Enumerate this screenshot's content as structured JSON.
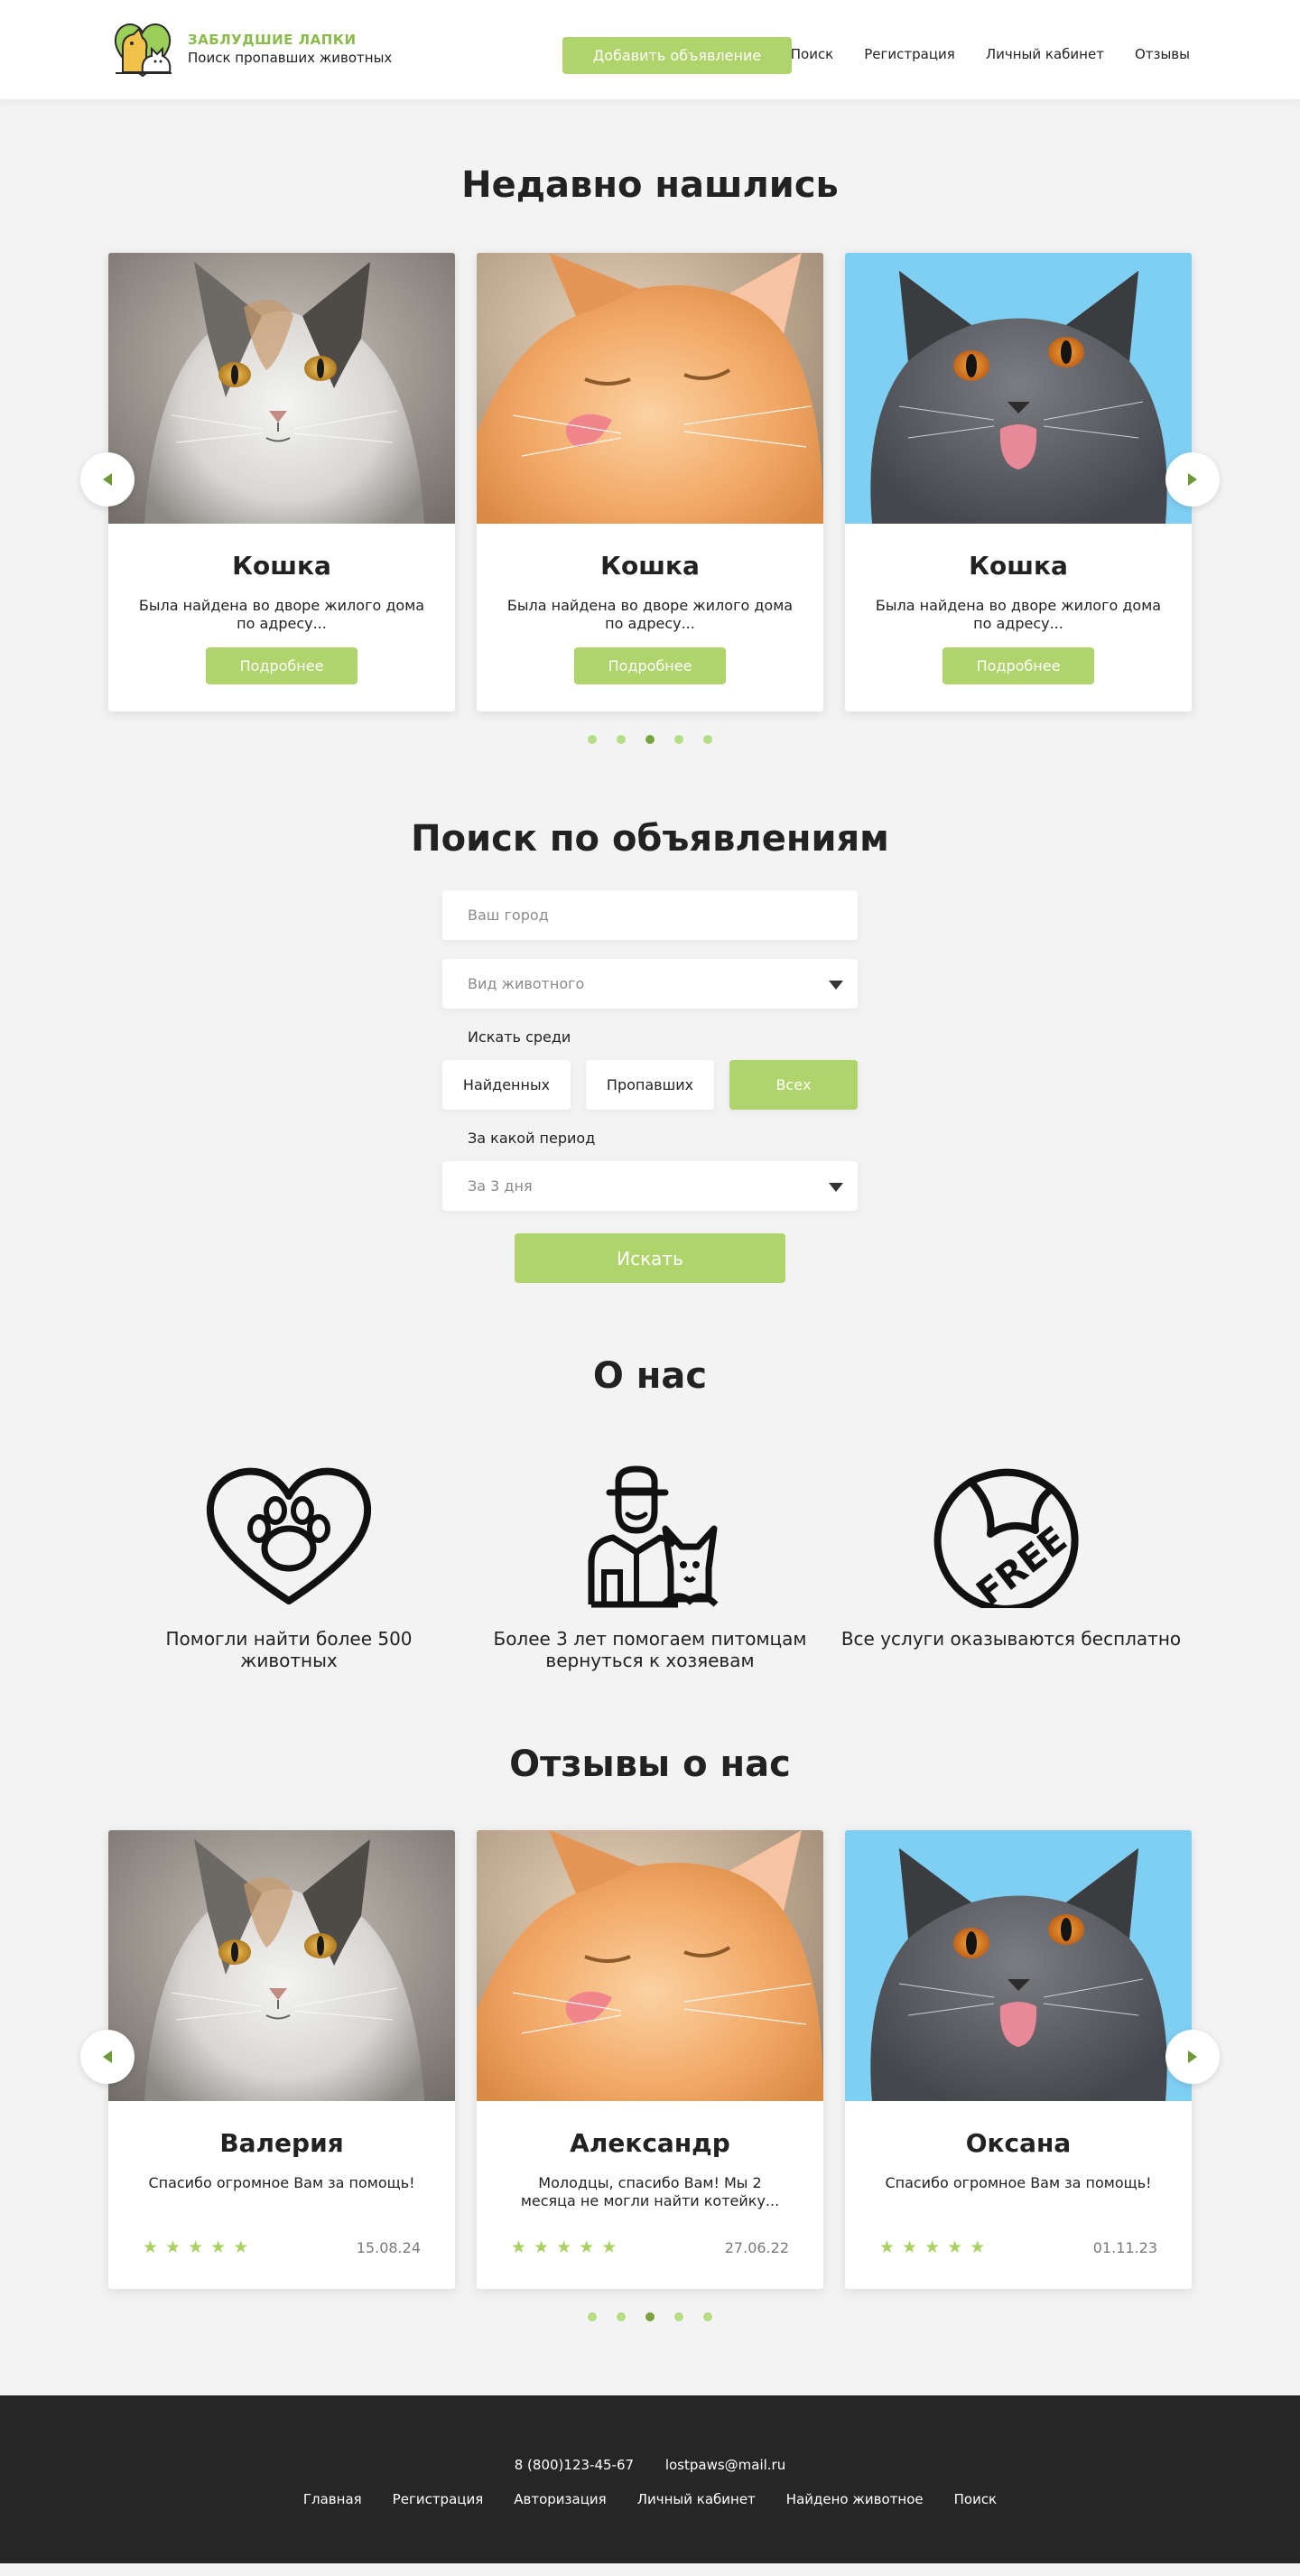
{
  "header": {
    "logo_title": "ЗАБЛУДШИЕ ЛАПКИ",
    "logo_subtitle": "Поиск пропавших животных",
    "add_button": "Добавить объявление",
    "nav": [
      "Поиск",
      "Регистрация",
      "Личный кабинет",
      "Отзывы"
    ]
  },
  "found": {
    "title": "Недавно нашлись",
    "cards": [
      {
        "name": "Кошка",
        "text": "Была найдена во дворе жилого дома по адресу...",
        "button": "Подробнее",
        "photo": "calico-cat-photo"
      },
      {
        "name": "Кошка",
        "text": "Была найдена во дворе жилого дома по адресу...",
        "button": "Подробнее",
        "photo": "ginger-kitten-photo"
      },
      {
        "name": "Кошка",
        "text": "Была найдена во дворе жилого дома по адресу...",
        "button": "Подробнее",
        "photo": "gray-british-cat-photo"
      }
    ],
    "active_dot": 2,
    "dot_count": 5
  },
  "search": {
    "title": "Поиск по объявлениям",
    "city_placeholder": "Ваш город",
    "animal_type": "Вид животного",
    "search_among_label": "Искать среди",
    "segments": [
      "Найденных",
      "Пропавших",
      "Всех"
    ],
    "active_segment": 2,
    "period_label": "За какой период",
    "period_value": "За 3 дня",
    "submit": "Искать"
  },
  "about": {
    "title": "О нас",
    "features": [
      {
        "icon": "heart-paw-icon",
        "text": "Помогли найти более 500 животных"
      },
      {
        "icon": "man-with-dog-icon",
        "text": "Более 3 лет помогаем питомцам вернуться к хозяевам"
      },
      {
        "icon": "free-sticker-icon",
        "text": "Все услуги оказываются бесплатно"
      }
    ]
  },
  "reviews": {
    "title": "Отзывы о нас",
    "items": [
      {
        "name": "Валерия",
        "text": "Спасибо огромное Вам за помощь!",
        "rating": 5,
        "date": "15.08.24"
      },
      {
        "name": "Александр",
        "text": "Молодцы, спасибо Вам! Мы 2 месяца не могли найти котейку...",
        "rating": 5,
        "date": "27.06.22"
      },
      {
        "name": "Оксана",
        "text": "Спасибо огромное Вам за помощь!",
        "rating": 5,
        "date": "01.11.23"
      }
    ],
    "active_dot": 2,
    "dot_count": 5
  },
  "footer": {
    "phone": "8 (800)123-45-67",
    "email": "lostpaws@mail.ru",
    "nav": [
      "Главная",
      "Регистрация",
      "Авторизация",
      "Личный кабинет",
      "Найдено животное",
      "Поиск"
    ]
  },
  "colors": {
    "accent": "#afd46b",
    "accent_dark": "#7aa33f",
    "background": "#f3f3f3",
    "footer": "#262626"
  }
}
